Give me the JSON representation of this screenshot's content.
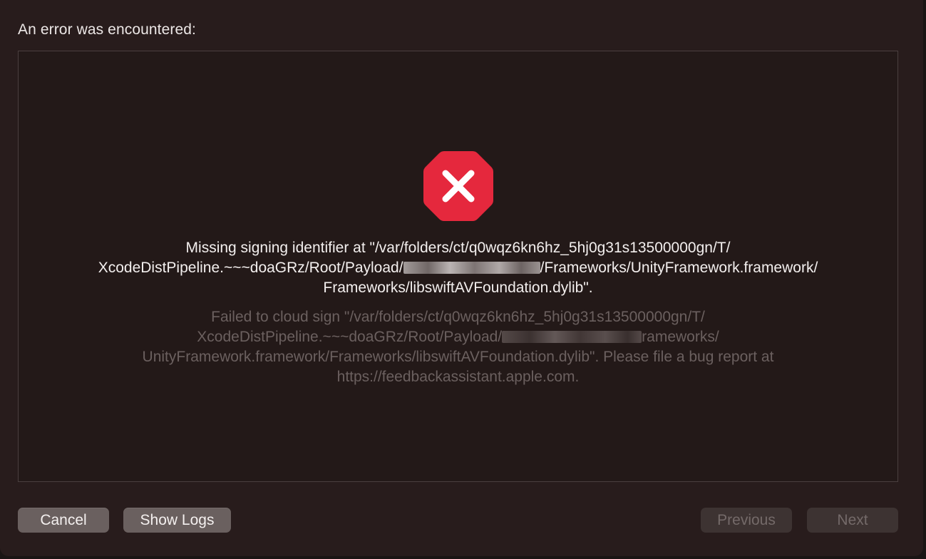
{
  "dialog": {
    "header": "An error was encountered:",
    "icon": "error-stop-icon",
    "primary_message": {
      "line1": "Missing signing identifier at \"/var/folders/ct/q0wqz6kn6hz_5hj0g31s13500000gn/T/",
      "line2_before": "XcodeDistPipeline.~~~doaGRz/Root/Payload/",
      "line2_after": "/Frameworks/UnityFramework.framework/",
      "line3": "Frameworks/libswiftAVFoundation.dylib\"."
    },
    "secondary_message": {
      "line1": "Failed to cloud sign \"/var/folders/ct/q0wqz6kn6hz_5hj0g31s13500000gn/T/",
      "line2_before": "XcodeDistPipeline.~~~doaGRz/Root/Payload/",
      "line2_after": "rameworks/",
      "line3": "UnityFramework.framework/Frameworks/libswiftAVFoundation.dylib\". Please file a bug report at",
      "line4": "https://feedbackassistant.apple.com."
    }
  },
  "buttons": {
    "cancel": "Cancel",
    "show_logs": "Show Logs",
    "previous": "Previous",
    "next": "Next"
  },
  "colors": {
    "window_bg": "#281c1c",
    "error_red": "#e5283d",
    "button_enabled": "#6a605f",
    "button_disabled": "#3d3332"
  }
}
